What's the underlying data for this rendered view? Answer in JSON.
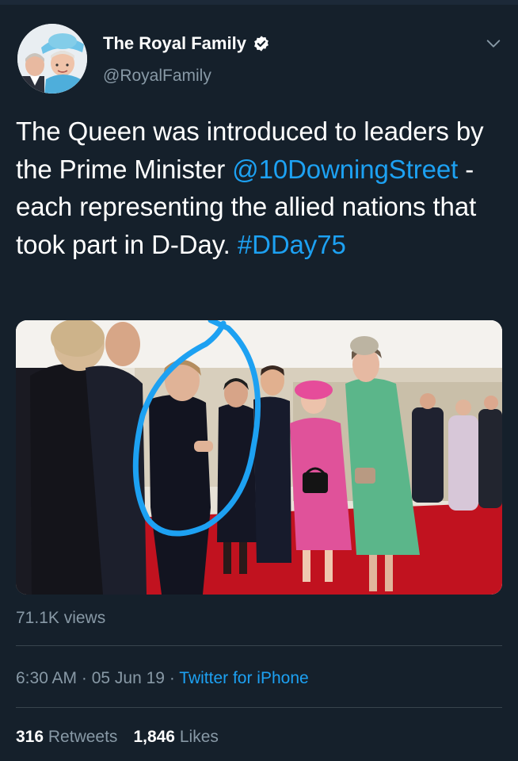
{
  "colors": {
    "background": "#15202b",
    "link": "#1da1f2",
    "secondary_text": "#8899a6",
    "divider": "#38444d",
    "annotation_circle": "#1da1f2"
  },
  "author": {
    "name": "The Royal Family",
    "handle": "@RoyalFamily",
    "verified_icon": "verified-badge-icon",
    "avatar_icon": "avatar-photo"
  },
  "tweet": {
    "text_part1": "The Queen was introduced to leaders by the Prime Minister ",
    "mention": "@10DowningStreet",
    "text_part2": " - each representing the allied nations that took part in D-Day. ",
    "hashtag": "#DDay75"
  },
  "media": {
    "type": "photo",
    "has_annotation": "hand-drawn blue circle around a person"
  },
  "views": "71.1K views",
  "meta": {
    "time": "6:30 AM",
    "separator": " · ",
    "date": "05 Jun 19",
    "source": "Twitter for iPhone"
  },
  "stats": {
    "retweets_count": "316",
    "retweets_label": "Retweets",
    "likes_count": "1,846",
    "likes_label": "Likes"
  }
}
